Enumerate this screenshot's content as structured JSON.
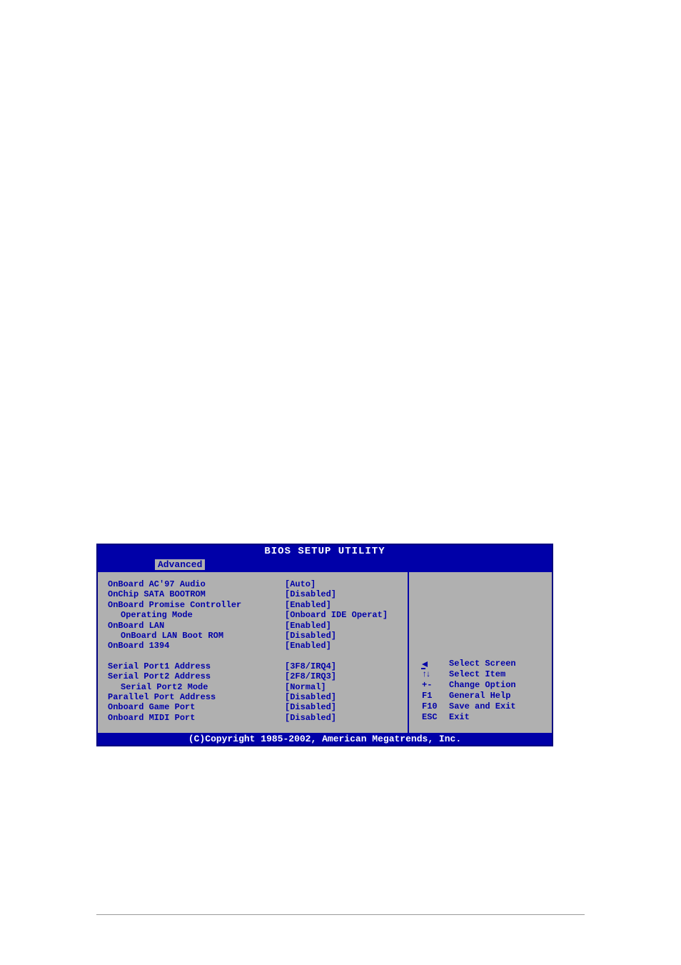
{
  "bios": {
    "title": "BIOS SETUP UTILITY",
    "tab": "Advanced",
    "settings_group1": [
      {
        "label": "OnBoard AC'97 Audio",
        "value": "[Auto]",
        "indent": 0
      },
      {
        "label": "OnChip SATA BOOTROM",
        "value": "[Disabled]",
        "indent": 0
      },
      {
        "label": "OnBoard Promise Controller",
        "value": "[Enabled]",
        "indent": 0
      },
      {
        "label": "Operating Mode",
        "value": "[Onboard IDE Operat]",
        "indent": 1
      },
      {
        "label": "OnBoard LAN",
        "value": "[Enabled]",
        "indent": 0
      },
      {
        "label": "OnBoard LAN Boot ROM",
        "value": "[Disabled]",
        "indent": 1
      },
      {
        "label": "OnBoard 1394",
        "value": "[Enabled]",
        "indent": 0
      }
    ],
    "settings_group2": [
      {
        "label": "Serial Port1 Address",
        "value": "[3F8/IRQ4]",
        "indent": 0
      },
      {
        "label": "Serial Port2 Address",
        "value": "[2F8/IRQ3]",
        "indent": 0
      },
      {
        "label": "Serial Port2 Mode",
        "value": "[Normal]",
        "indent": 1
      },
      {
        "label": "Parallel Port Address",
        "value": "[Disabled]",
        "indent": 0
      },
      {
        "label": "Onboard Game Port",
        "value": "[Disabled]",
        "indent": 0
      },
      {
        "label": "Onboard MIDI Port",
        "value": "[Disabled]",
        "indent": 0
      }
    ],
    "help": [
      {
        "key_icon": "arrow-left",
        "key_text": "",
        "desc": "Select Screen"
      },
      {
        "key_icon": "updown",
        "key_text": "↑↓",
        "desc": "Select Item"
      },
      {
        "key_icon": "",
        "key_text": "+-",
        "desc": "Change Option"
      },
      {
        "key_icon": "",
        "key_text": "F1",
        "desc": "General Help"
      },
      {
        "key_icon": "",
        "key_text": "F10",
        "desc": "Save and Exit"
      },
      {
        "key_icon": "",
        "key_text": "ESC",
        "desc": "Exit"
      }
    ],
    "footer": "(C)Copyright 1985-2002, American Megatrends, Inc."
  }
}
